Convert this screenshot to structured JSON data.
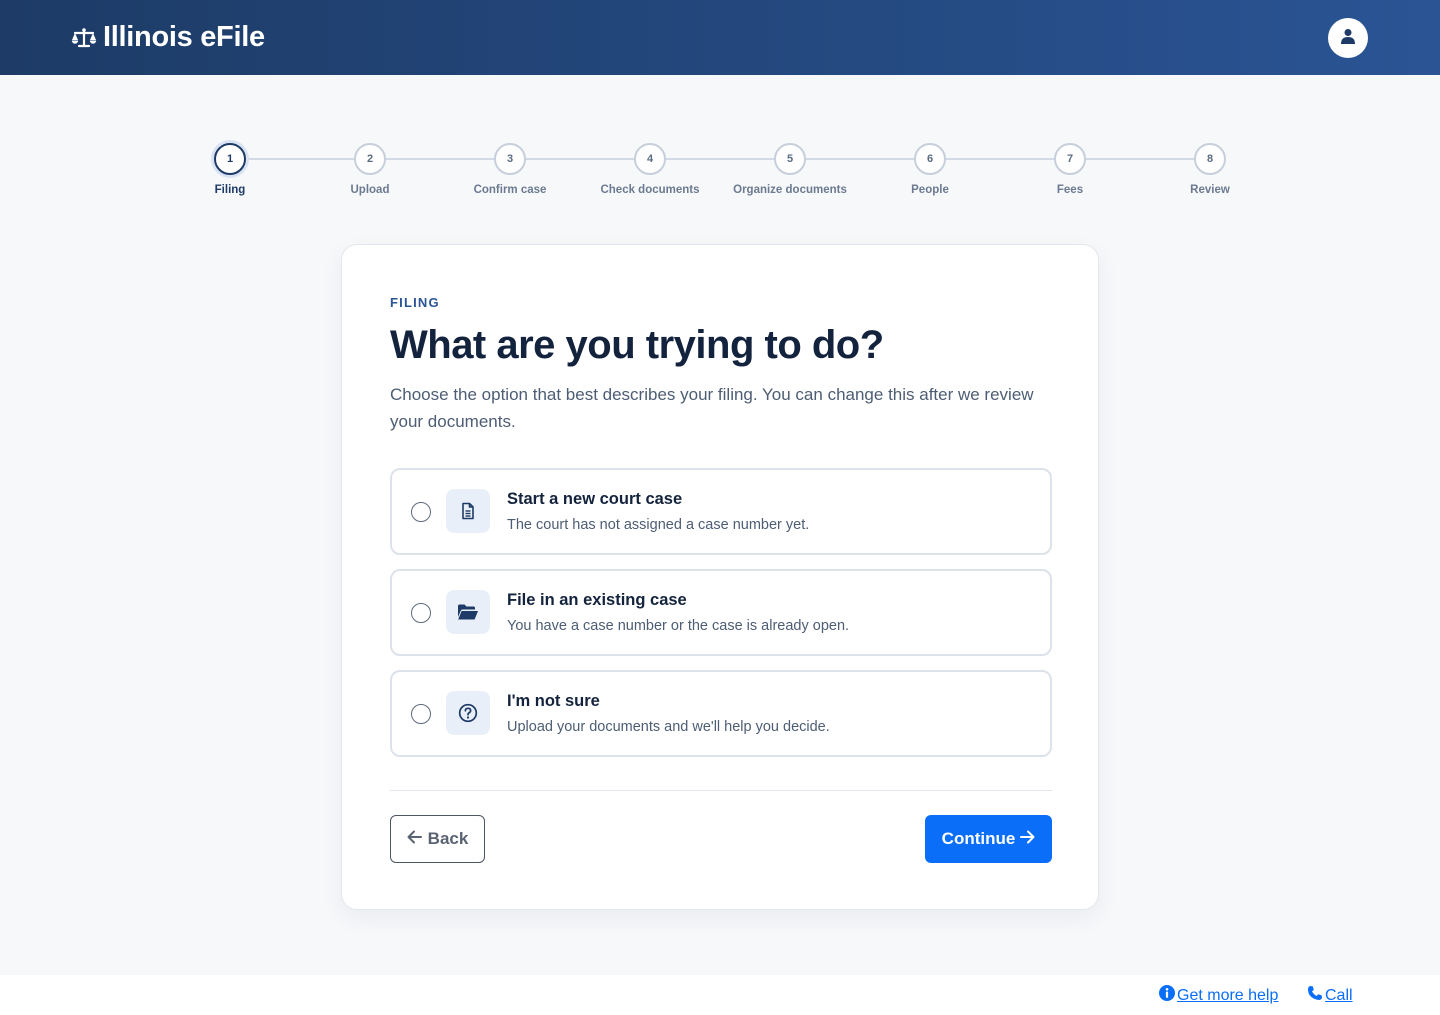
{
  "header": {
    "app_title": "Illinois eFile",
    "logo_icon": "scales-icon",
    "account_icon": "user-icon"
  },
  "stepper": {
    "active_step": 1,
    "steps": [
      {
        "number": "1",
        "label": "Filing"
      },
      {
        "number": "2",
        "label": "Upload"
      },
      {
        "number": "3",
        "label": "Confirm case"
      },
      {
        "number": "4",
        "label": "Check documents"
      },
      {
        "number": "5",
        "label": "Organize documents"
      },
      {
        "number": "6",
        "label": "People"
      },
      {
        "number": "7",
        "label": "Fees"
      },
      {
        "number": "8",
        "label": "Review"
      }
    ]
  },
  "card": {
    "eyebrow": "FILING",
    "title": "What are you trying to do?",
    "description": "Choose the option that best describes your filing. You can change this after we review your documents.",
    "options": [
      {
        "title": "Start a new court case",
        "subtitle": "The court has not assigned a case number yet.",
        "icon": "document-icon",
        "selected": false
      },
      {
        "title": "File in an existing case",
        "subtitle": "You have a case number or the case is already open.",
        "icon": "folder-open-icon",
        "selected": false
      },
      {
        "title": "I'm not sure",
        "subtitle": "Upload your documents and we'll help you decide.",
        "icon": "question-circle-icon",
        "selected": false
      }
    ],
    "back_label": "Back",
    "continue_label": "Continue"
  },
  "footer": {
    "help_label": "Get more help",
    "call_label": "Call"
  },
  "colors": {
    "header_start": "#1d3b66",
    "header_end": "#2a5494",
    "primary": "#0b6ef8",
    "accent": "#2a5494"
  }
}
